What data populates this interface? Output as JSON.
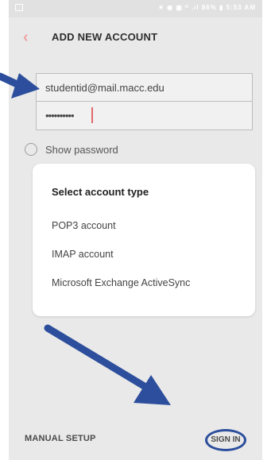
{
  "status_bar": {
    "right_text": "✶ ◉ ▣ ᴴ .ıl 86% ▮ 5:53 AM"
  },
  "header": {
    "title": "ADD NEW ACCOUNT"
  },
  "form": {
    "email_value": "studentid@mail.macc.edu",
    "password_value": "••••••••••",
    "show_password_label": "Show password"
  },
  "modal": {
    "title": "Select account type",
    "options": [
      "POP3 account",
      "IMAP account",
      "Microsoft Exchange ActiveSync"
    ]
  },
  "bottom": {
    "manual_setup": "MANUAL SETUP",
    "sign_in": "SIGN IN"
  },
  "colors": {
    "accent": "#f0a3a3",
    "annotation": "#2c4e9c"
  }
}
